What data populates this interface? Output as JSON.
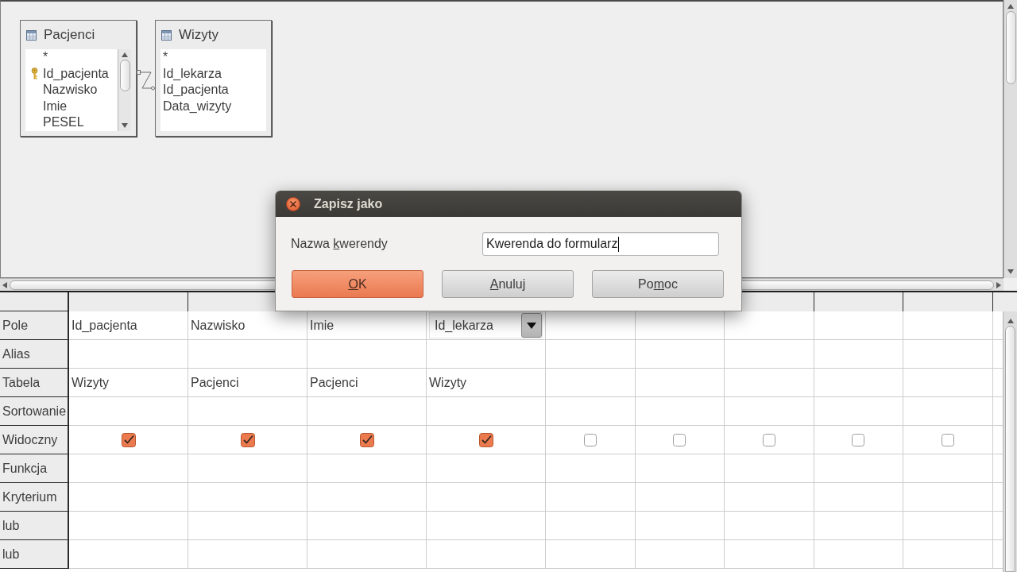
{
  "design_view": {
    "tables": [
      {
        "title": "Pacjenci",
        "scrollbar": true,
        "fields": [
          {
            "name": "*",
            "primary_key": false
          },
          {
            "name": "Id_pacjenta",
            "primary_key": true
          },
          {
            "name": "Nazwisko",
            "primary_key": false
          },
          {
            "name": "Imie",
            "primary_key": false
          },
          {
            "name": "PESEL",
            "primary_key": false
          }
        ]
      },
      {
        "title": "Wizyty",
        "scrollbar": false,
        "fields": [
          {
            "name": "*",
            "primary_key": false
          },
          {
            "name": "Id_lekarza",
            "primary_key": false
          },
          {
            "name": "Id_pacjenta",
            "primary_key": false
          },
          {
            "name": "Data_wizyty",
            "primary_key": false
          }
        ]
      }
    ]
  },
  "query_grid": {
    "rows": [
      {
        "label": "Pole",
        "kind": "field"
      },
      {
        "label": "Alias",
        "kind": "alias"
      },
      {
        "label": "Tabela",
        "kind": "table"
      },
      {
        "label": "Sortowanie",
        "kind": "sort"
      },
      {
        "label": "Widoczny",
        "kind": "visible"
      },
      {
        "label": "Funkcja",
        "kind": "function"
      },
      {
        "label": "Kryterium",
        "kind": "criterion"
      },
      {
        "label": "lub",
        "kind": "or"
      },
      {
        "label": "lub",
        "kind": "or"
      }
    ],
    "columns": [
      {
        "field": "Id_pacjenta",
        "table": "Wizyty",
        "visible": true,
        "editing": false
      },
      {
        "field": "Nazwisko",
        "table": "Pacjenci",
        "visible": true,
        "editing": false
      },
      {
        "field": "Imie",
        "table": "Pacjenci",
        "visible": true,
        "editing": false
      },
      {
        "field": "Id_lekarza",
        "table": "Wizyty",
        "visible": true,
        "editing": true
      },
      {
        "visible": false,
        "editing": false
      },
      {
        "visible": false,
        "editing": false
      },
      {
        "visible": false,
        "editing": false
      },
      {
        "visible": false,
        "editing": false
      },
      {
        "visible": false,
        "editing": false
      }
    ]
  },
  "dialog": {
    "title": "Zapisz jako",
    "label": {
      "before": "Nazwa ",
      "access_key": "k",
      "after": "werendy"
    },
    "name_field": {
      "value": "Kwerenda do formularz"
    },
    "buttons": [
      {
        "access_key": "O",
        "after": "K",
        "default": true
      },
      {
        "access_key": "A",
        "after": "nuluj",
        "default": false
      },
      {
        "before": "Po",
        "access_key": "m",
        "after": "oc",
        "default": false
      }
    ]
  }
}
